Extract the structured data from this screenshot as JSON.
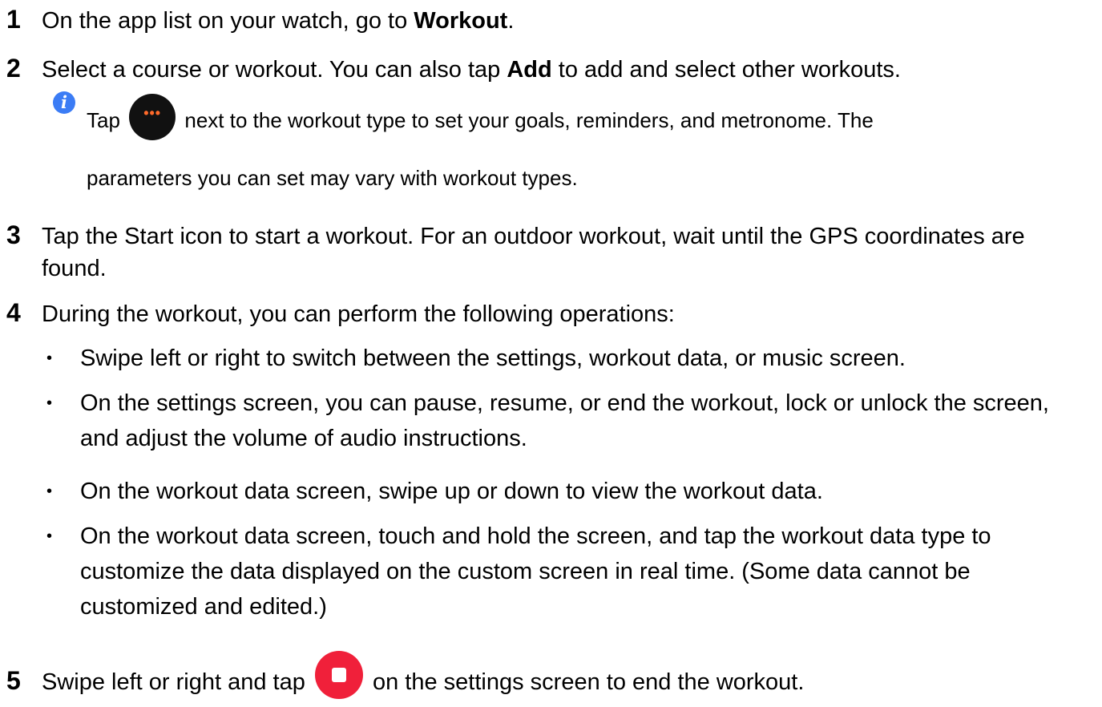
{
  "steps": [
    {
      "num": "1",
      "pre": "On the app list on your watch, go to ",
      "bold": "Workout",
      "post": "."
    },
    {
      "num": "2",
      "pre": "Select a course or workout. You can also tap ",
      "bold": "Add",
      "post": " to add and select other workouts."
    },
    {
      "num": "3",
      "text": "Tap the Start icon to start a workout. For an outdoor workout, wait until the GPS coordinates are found."
    },
    {
      "num": "4",
      "text": "During the workout, you can perform the following operations:"
    },
    {
      "num": "5",
      "pre": "Swipe left or right and tap ",
      "post": " on the settings screen to end the workout."
    }
  ],
  "note": {
    "icon": "info-icon",
    "pre": "Tap ",
    "post": " next to the workout type to set your goals, reminders, and metronome. The",
    "line2": "parameters you can set may vary with workout types."
  },
  "bullets": [
    "Swipe left or right to switch between the settings, workout data, or music screen.",
    "On the settings screen, you can pause, resume, or end the workout, lock or unlock the screen, and adjust the volume of audio instructions.",
    "On the workout data screen, swipe up or down to view the workout data.",
    "On the workout data screen, touch and hold the screen, and tap the workout data type to customize the data displayed on the custom screen in real time. (Some data cannot be customized and edited.)"
  ],
  "colors": {
    "info": "#3b7cf5",
    "more_bg": "#111111",
    "more_dots": "#ff6a2a",
    "stop": "#f0203a"
  }
}
